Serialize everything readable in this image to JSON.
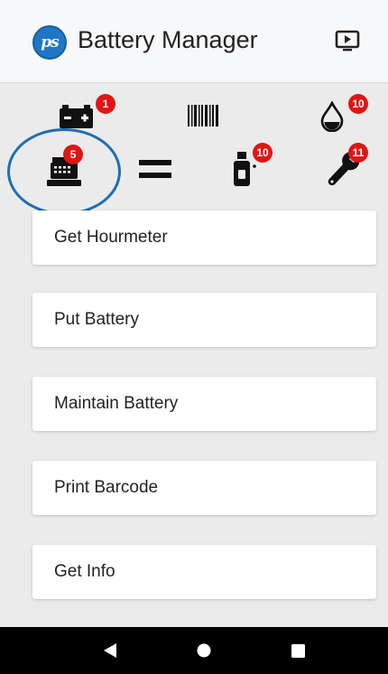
{
  "header": {
    "logo_text": "ps",
    "title": "Battery Manager",
    "cast_icon": "screen-cast-icon"
  },
  "status_icons": {
    "battery": {
      "icon": "battery-icon",
      "badge": "1"
    },
    "barcode": {
      "icon": "barcode-icon"
    },
    "water": {
      "icon": "water-drop-icon",
      "badge": "10"
    },
    "register": {
      "icon": "cash-register-icon",
      "badge": "5"
    },
    "equals": {
      "icon": "equals-icon"
    },
    "spray": {
      "icon": "spray-bottle-icon",
      "badge": "10"
    },
    "wrench": {
      "icon": "wrench-icon",
      "badge": "11"
    }
  },
  "menu": {
    "items": [
      {
        "label": "Get Hourmeter"
      },
      {
        "label": "Put Battery"
      },
      {
        "label": "Maintain Battery"
      },
      {
        "label": "Print Barcode"
      },
      {
        "label": "Get Info"
      }
    ]
  },
  "nav": {
    "back_icon": "back-triangle-icon",
    "home_icon": "home-circle-icon",
    "recents_icon": "recents-square-icon"
  },
  "colors": {
    "accent": "#1f76c4",
    "badge": "#e01515",
    "highlight": "#1f6db7"
  }
}
